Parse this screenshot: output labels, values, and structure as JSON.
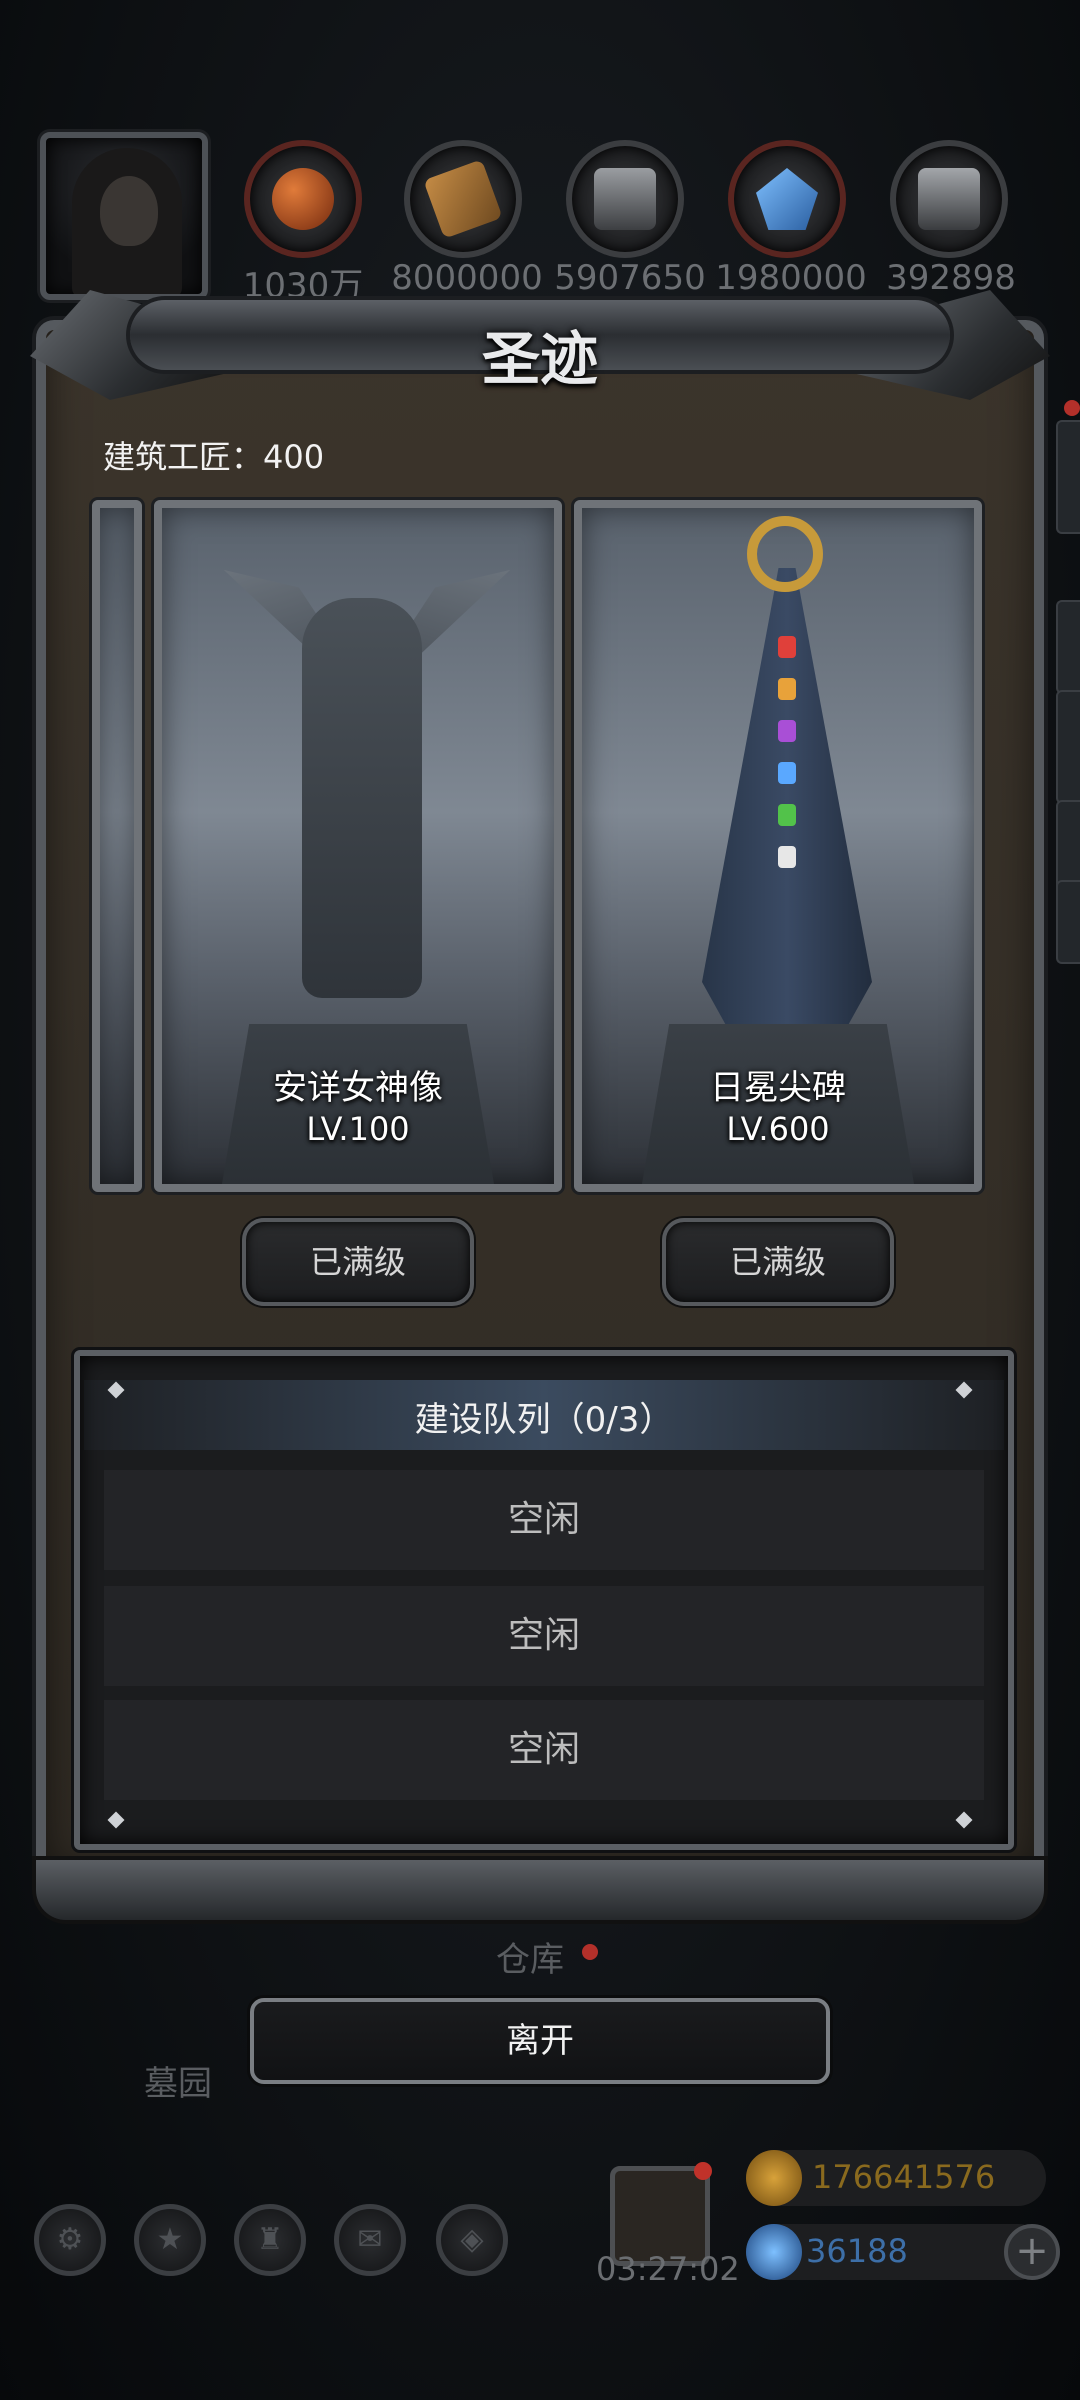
{
  "resources": [
    {
      "name": "meat-icon",
      "value": "1030万",
      "color": "#c0652e"
    },
    {
      "name": "wood-icon",
      "value": "8000000",
      "color": "#a1743c"
    },
    {
      "name": "stone-icon",
      "value": "5907650",
      "color": "#8a8d91"
    },
    {
      "name": "crystal-icon",
      "value": "1980000",
      "color": "#3f7fc6"
    },
    {
      "name": "iron-icon",
      "value": "392898",
      "color": "#8e9195"
    }
  ],
  "panel": {
    "title": "圣迹",
    "builders": "建筑工匠：400"
  },
  "cards": [
    {
      "name": "安详女神像",
      "level": "LV.100",
      "button": "已满级"
    },
    {
      "name": "日冕尖碑",
      "level": "LV.600",
      "button": "已满级"
    }
  ],
  "queue": {
    "title": "建设队列（0/3）",
    "slots": [
      "空闲",
      "空闲",
      "空闲"
    ]
  },
  "background": {
    "warehouse": "仓库",
    "cemetery": "墓园"
  },
  "leave_label": "离开",
  "bottom": {
    "timer": "03:27:02",
    "gold": "176641576",
    "gems": "36188",
    "plus": "+"
  },
  "colors": {
    "gold_text": "#8a6a1e",
    "gem_text": "#3d6fa8",
    "panel_bg": "#3b342b"
  }
}
